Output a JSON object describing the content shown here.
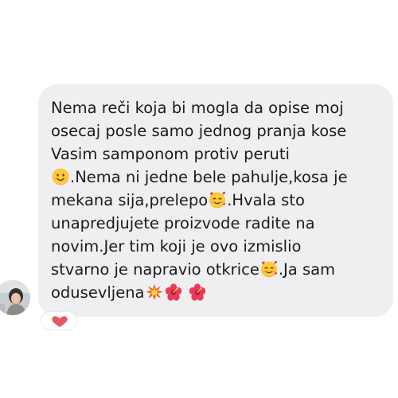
{
  "message": {
    "lines": [
      [
        "Nema reči koja bi mogla da opise moj"
      ],
      [
        "osecaj posle samo jednog pranja kose"
      ],
      [
        "Vasim samponom protiv peruti"
      ],
      [
        {
          "icon": "smiling-face-icon"
        },
        ".Nema ni jedne bele pahulje,kosa je"
      ],
      [
        "mekana sija,prelepo",
        {
          "icon": "smiling-face-hearts-icon"
        },
        ".Hvala sto"
      ],
      [
        "unapredjujete proizvode radite na"
      ],
      [
        "novim.Jer tim koji je ovo izmislio"
      ],
      [
        "stvarno je napravio otkrice",
        {
          "icon": "smiling-face-hearts-icon"
        },
        ".Ja sam"
      ],
      [
        "odusevljena",
        {
          "icon": "collision-icon"
        },
        {
          "icon": "hibiscus-icon"
        },
        " ",
        {
          "icon": "hibiscus-icon"
        }
      ]
    ]
  },
  "reaction": {
    "icon": "heart-icon",
    "color": "#e05a66"
  },
  "colors": {
    "bubble": "#efeff2",
    "text": "#1b1b1b",
    "background": "#ffffff"
  }
}
